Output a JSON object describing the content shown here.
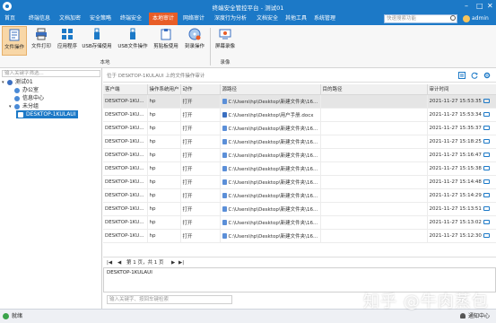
{
  "window": {
    "title": "终端安全管控平台 - 测试01"
  },
  "menu": {
    "items": [
      "首页",
      "终端信息",
      "文档加密",
      "安全策略",
      "终端安全",
      "本地审计",
      "网络审计",
      "深度行为分析",
      "文档安全",
      "其他工具",
      "系统管理"
    ],
    "active_index": 5,
    "search_placeholder": "快速搜索功能",
    "user": "admin"
  },
  "ribbon": {
    "buttons": [
      {
        "label": "文件操作",
        "icon": "file-operation-icon",
        "active": true
      },
      {
        "label": "文件打印",
        "icon": "printer-icon",
        "active": false
      },
      {
        "label": "应用程序",
        "icon": "apps-icon",
        "active": false
      },
      {
        "label": "USB存储使用",
        "icon": "usb-storage-icon",
        "active": false
      },
      {
        "label": "USB文件操作",
        "icon": "usb-file-icon",
        "active": false
      },
      {
        "label": "剪贴板使用",
        "icon": "clipboard-icon",
        "active": false
      },
      {
        "label": "刻录操作",
        "icon": "burn-disc-icon",
        "active": false
      },
      {
        "label": "屏幕录像",
        "icon": "screen-record-icon",
        "active": false
      }
    ],
    "groups": [
      "本地",
      "录像"
    ]
  },
  "left_panel": {
    "search_placeholder": "输入关键字筛选...",
    "tree": [
      {
        "label": "测试01",
        "level": 0,
        "toggle": "▾",
        "color": "#3a6fc1"
      },
      {
        "label": "办公室",
        "level": 1,
        "toggle": "",
        "color": "#4a8ad6"
      },
      {
        "label": "信息中心",
        "level": 1,
        "toggle": "",
        "color": "#4a8ad6"
      },
      {
        "label": "未分组",
        "level": 1,
        "toggle": "▾",
        "color": "#4a8ad6"
      },
      {
        "label": "DESKTOP-1KULAUI",
        "level": 2,
        "toggle": "",
        "color": "#2c7bd0",
        "selected": true
      }
    ]
  },
  "right_panel": {
    "context_label": "位于 DESKTOP-1KULAUI 上的文件操作审计",
    "columns": [
      "客户端",
      "操作系统用户",
      "动作",
      "源路径",
      "目的路径",
      "审计时间"
    ],
    "rows": [
      {
        "client": "DESKTOP-1KU...",
        "user": "hp",
        "action": "打开",
        "icon": "exe",
        "src": "C:\\Users\\hp\\Desktop\\新建文件夹\\16...",
        "dst": "",
        "time": "2021-11-27 15:53:35"
      },
      {
        "client": "DESKTOP-1KU...",
        "user": "hp",
        "action": "打开",
        "icon": "doc",
        "src": "C:\\Users\\hp\\Desktop\\用户手册.docx",
        "dst": "",
        "time": "2021-11-27 15:53:34"
      },
      {
        "client": "DESKTOP-1KU...",
        "user": "hp",
        "action": "打开",
        "icon": "exe",
        "src": "C:\\Users\\hp\\Desktop\\新建文件夹\\16...",
        "dst": "",
        "time": "2021-11-27 15:35:37"
      },
      {
        "client": "DESKTOP-1KU...",
        "user": "hp",
        "action": "打开",
        "icon": "exe",
        "src": "C:\\Users\\hp\\Desktop\\新建文件夹\\16...",
        "dst": "",
        "time": "2021-11-27 15:18:25"
      },
      {
        "client": "DESKTOP-1KU...",
        "user": "hp",
        "action": "打开",
        "icon": "exe",
        "src": "C:\\Users\\hp\\Desktop\\新建文件夹\\16...",
        "dst": "",
        "time": "2021-11-27 15:16:47"
      },
      {
        "client": "DESKTOP-1KU...",
        "user": "hp",
        "action": "打开",
        "icon": "exe",
        "src": "C:\\Users\\hp\\Desktop\\新建文件夹\\16...",
        "dst": "",
        "time": "2021-11-27 15:15:38"
      },
      {
        "client": "DESKTOP-1KU...",
        "user": "hp",
        "action": "打开",
        "icon": "exe",
        "src": "C:\\Users\\hp\\Desktop\\新建文件夹\\16...",
        "dst": "",
        "time": "2021-11-27 15:14:48"
      },
      {
        "client": "DESKTOP-1KU...",
        "user": "hp",
        "action": "打开",
        "icon": "exe",
        "src": "C:\\Users\\hp\\Desktop\\新建文件夹\\16...",
        "dst": "",
        "time": "2021-11-27 15:14:29"
      },
      {
        "client": "DESKTOP-1KU...",
        "user": "hp",
        "action": "打开",
        "icon": "exe",
        "src": "C:\\Users\\hp\\Desktop\\新建文件夹\\16...",
        "dst": "",
        "time": "2021-11-27 15:13:51"
      },
      {
        "client": "DESKTOP-1KU...",
        "user": "hp",
        "action": "打开",
        "icon": "exe",
        "src": "C:\\Users\\hp\\Desktop\\新建文件夹\\16...",
        "dst": "",
        "time": "2021-11-27 15:13:02"
      },
      {
        "client": "DESKTOP-1KU...",
        "user": "hp",
        "action": "打开",
        "icon": "exe",
        "src": "C:\\Users\\hp\\Desktop\\新建文件夹\\16...",
        "dst": "",
        "time": "2021-11-27 15:12:30"
      }
    ],
    "pager": {
      "first": "|◀",
      "prev": "◀",
      "text": "第 1 页，共 1 页",
      "next": "▶",
      "last": "▶|"
    },
    "detail_text": "DESKTOP-1KULAUI",
    "command_placeholder": "输入关键字、按回车键检索"
  },
  "statusbar": {
    "status": "就绪",
    "notifications": "通知中心"
  },
  "watermark": "知乎 @牛肉蒸包",
  "colors": {
    "brand": "#1c79c7",
    "active_tab": "#e85d27"
  }
}
